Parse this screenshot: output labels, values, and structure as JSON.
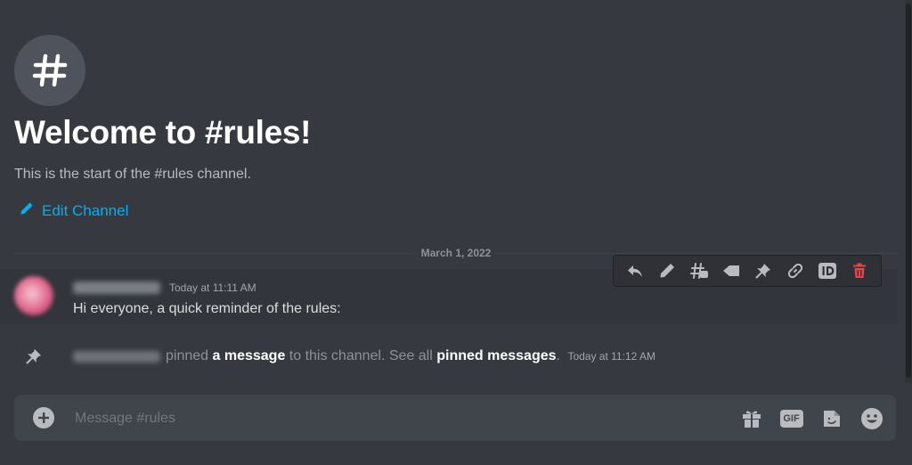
{
  "channel": {
    "welcome_title": "Welcome to #rules!",
    "welcome_subtitle": "This is the start of the #rules channel.",
    "edit_label": "Edit Channel"
  },
  "divider": {
    "date": "March 1, 2022"
  },
  "message": {
    "timestamp": "Today at 11:11 AM",
    "text": "Hi everyone, a quick reminder of the rules:"
  },
  "toolbar": {
    "icons": [
      "reply-icon",
      "edit-icon",
      "create-thread-icon",
      "mark-unread-icon",
      "pin-icon",
      "copy-link-icon",
      "copy-id-icon",
      "delete-icon"
    ],
    "delete_color": "#ed4245"
  },
  "system_message": {
    "pinned_word": "pinned",
    "link_text": "a message",
    "middle_text": "to this channel. See all",
    "pinned_link": "pinned messages",
    "end_text": ".",
    "timestamp": "Today at 11:12 AM"
  },
  "composer": {
    "placeholder": "Message #rules",
    "gif_label": "GIF",
    "icons": [
      "add-icon",
      "gift-icon",
      "gif-icon",
      "sticker-icon",
      "emoji-icon"
    ]
  },
  "colors": {
    "background": "#36393f",
    "accent_link": "#00b0f4",
    "composer": "#40444b"
  }
}
